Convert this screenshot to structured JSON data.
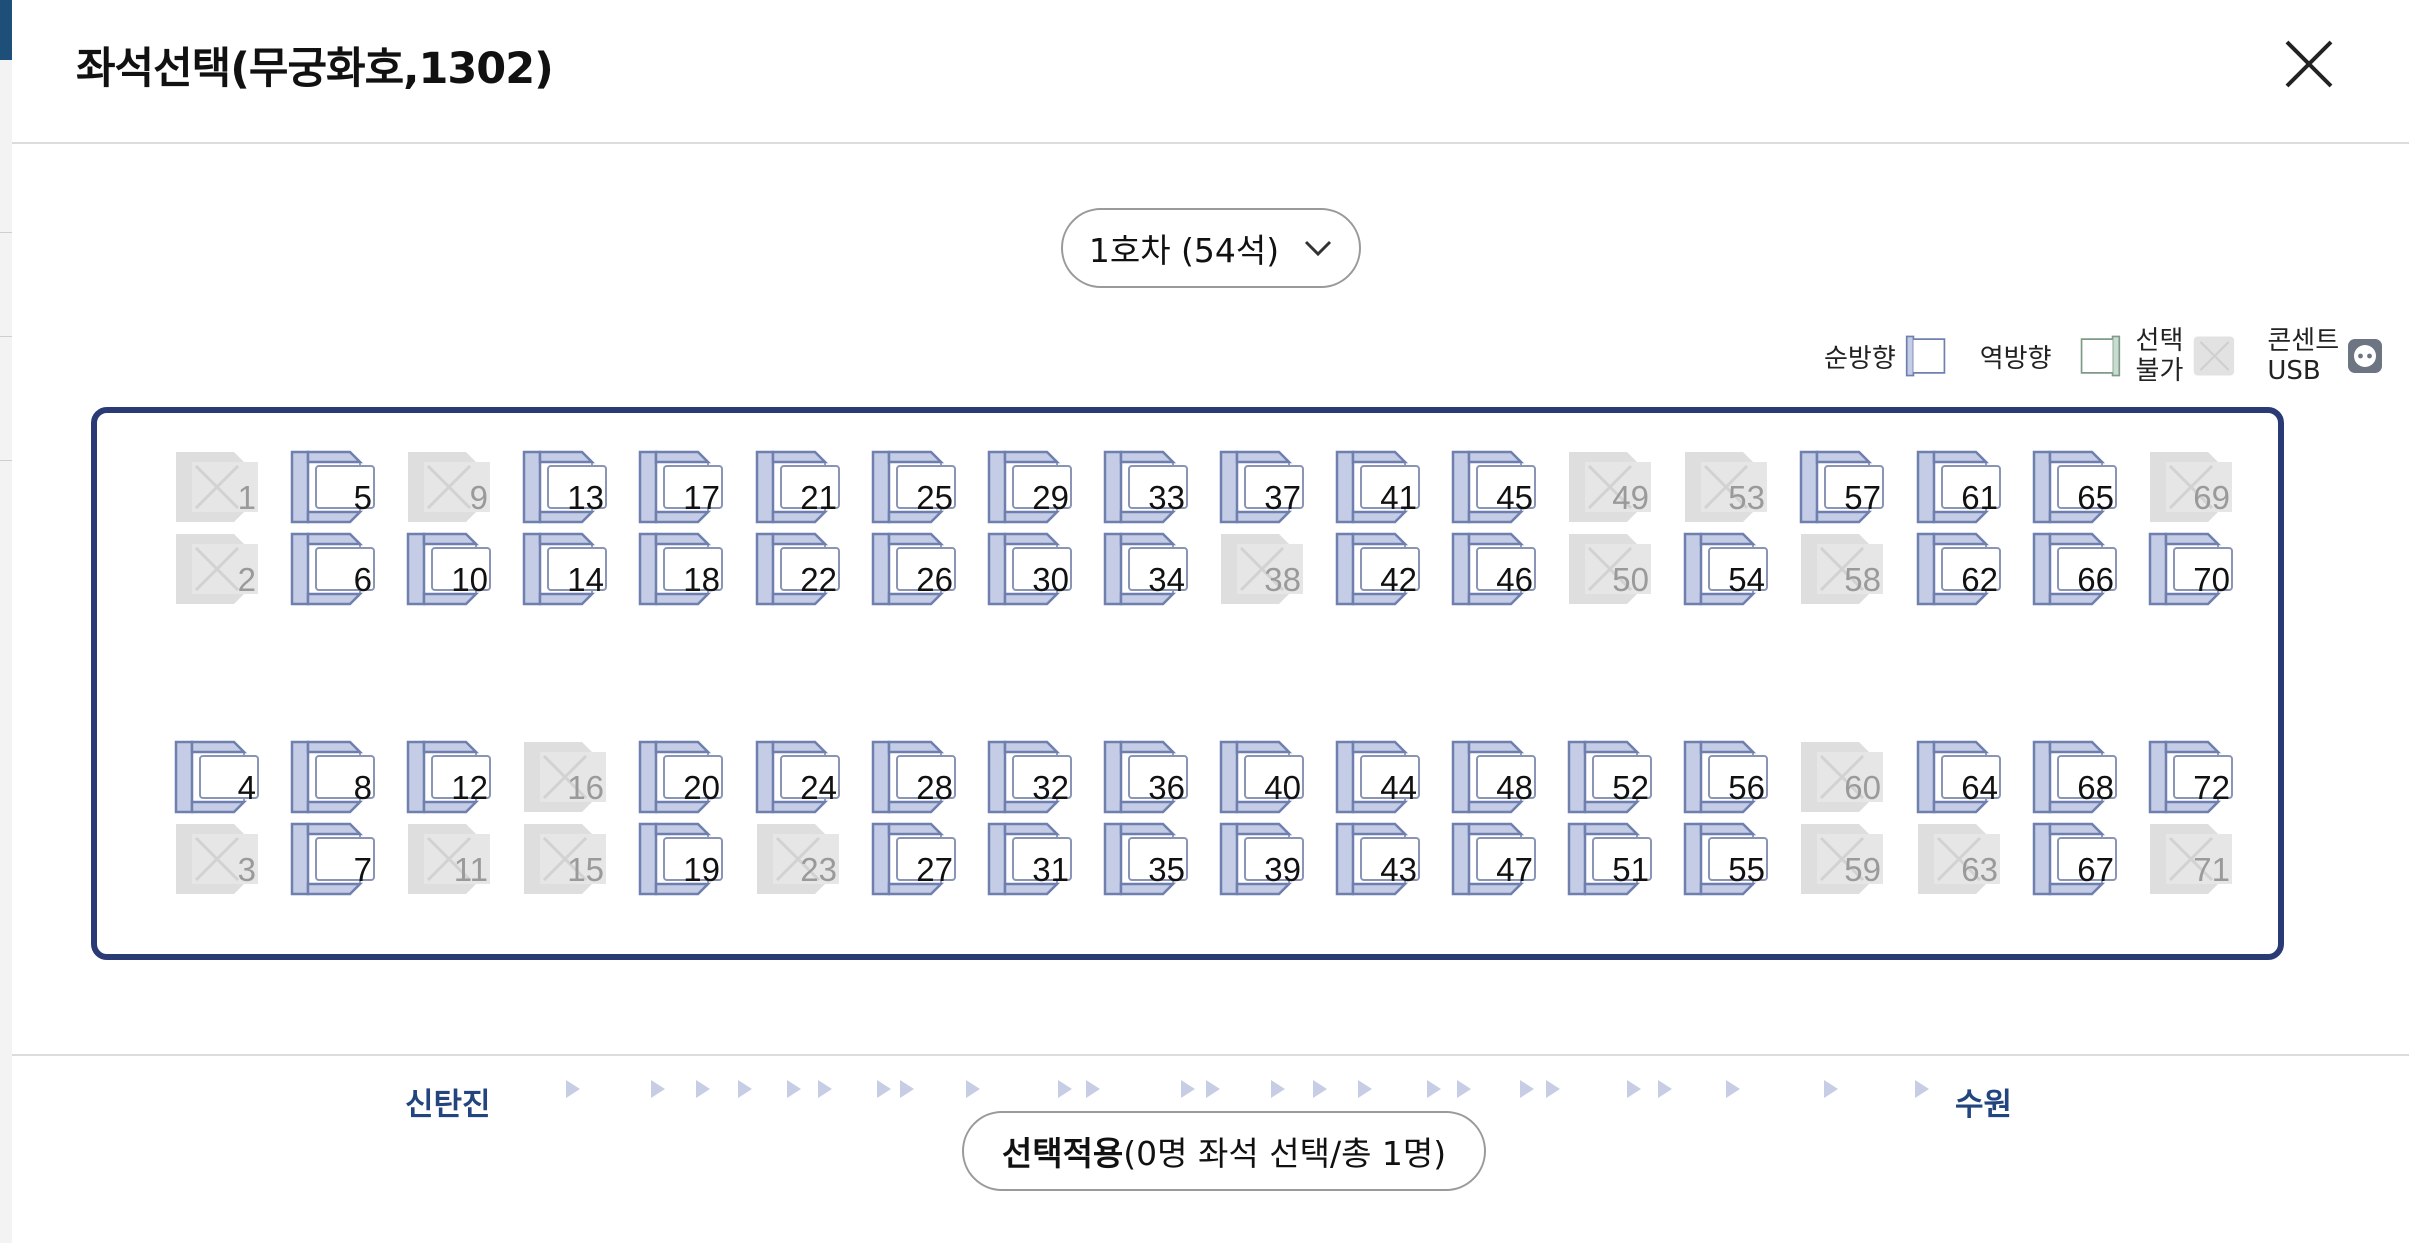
{
  "modal": {
    "title": "좌석선택(무궁화호,1302)",
    "close_icon": "close-icon"
  },
  "car_select": {
    "selected": "1호차 (54석)",
    "icon": "chevron-down-icon"
  },
  "legend": {
    "forward_label": "순방향",
    "backward_label": "역방향",
    "unavailable_label_1": "선택",
    "unavailable_label_2": "불가",
    "outlet_label_1": "콘센트",
    "outlet_label_2": "USB",
    "outlet_icon": "usb-outlet-icon"
  },
  "route": {
    "from": "신탄진",
    "to": "수원",
    "direction_icon": "direction-arrow-icon"
  },
  "seats": {
    "columns": [
      [
        "1",
        "2",
        "4",
        "3"
      ],
      [
        "5",
        "6",
        "8",
        "7"
      ],
      [
        "9",
        "10",
        "12",
        "11"
      ],
      [
        "13",
        "14",
        "16",
        "15"
      ],
      [
        "17",
        "18",
        "20",
        "19"
      ],
      [
        "21",
        "22",
        "24",
        "23"
      ],
      [
        "25",
        "26",
        "28",
        "27"
      ],
      [
        "29",
        "30",
        "32",
        "31"
      ],
      [
        "33",
        "34",
        "36",
        "35"
      ],
      [
        "37",
        "38",
        "40",
        "39"
      ],
      [
        "41",
        "42",
        "44",
        "43"
      ],
      [
        "45",
        "46",
        "48",
        "47"
      ],
      [
        "49",
        "50",
        "52",
        "51"
      ],
      [
        "53",
        "54",
        "56",
        "55"
      ],
      [
        "57",
        "58",
        "60",
        "59"
      ],
      [
        "61",
        "62",
        "64",
        "63"
      ],
      [
        "65",
        "66",
        "68",
        "67"
      ],
      [
        "69",
        "70",
        "72",
        "71"
      ]
    ],
    "unavailable": [
      "1",
      "2",
      "3",
      "9",
      "11",
      "15",
      "16",
      "23",
      "38",
      "49",
      "50",
      "53",
      "58",
      "59",
      "60",
      "63",
      "69",
      "71"
    ],
    "colors": {
      "available_fill": "#c5cde6",
      "available_stroke": "#6f7fae",
      "unavailable_fill": "#e2e2e2",
      "frame": "#293a74",
      "station": "#23457f"
    }
  },
  "apply_button": {
    "strong": "선택적용",
    "rest": "(0명 좌석 선택/총 1명)"
  }
}
